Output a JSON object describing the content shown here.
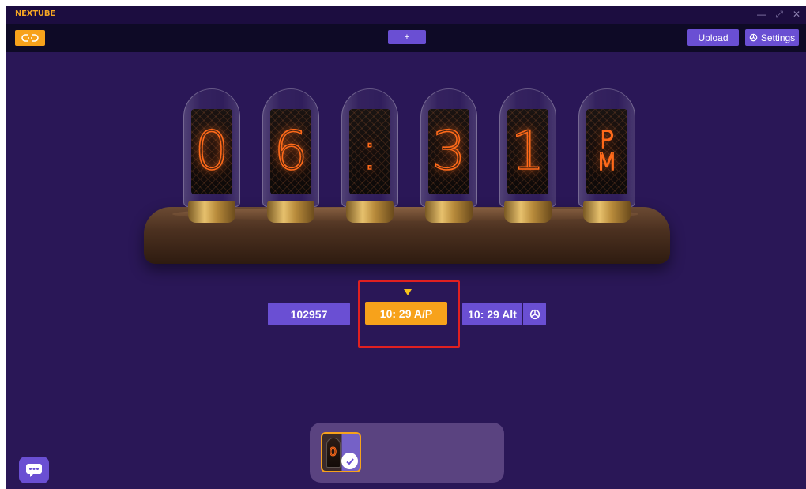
{
  "app": {
    "name": "NEXTUBE"
  },
  "window_controls": {
    "minimize": "—",
    "restore": "⤢",
    "close": "✕"
  },
  "toolbar": {
    "add_label": "+",
    "upload_label": "Upload",
    "settings_label": "Settings"
  },
  "clock": {
    "digits": [
      "0",
      "6",
      ":",
      "3",
      "1"
    ],
    "ampm": [
      "P",
      "M"
    ]
  },
  "modes": {
    "items": [
      {
        "label": "102957",
        "selected": false
      },
      {
        "label": "10: 29 A/P",
        "selected": true
      },
      {
        "label": "10: 29 Alt",
        "selected": false
      }
    ]
  },
  "tray": {
    "thumbnail_digit": "0"
  },
  "colors": {
    "accent": "#f7a21b",
    "primary": "#6a4fd3",
    "background": "#2a1757",
    "highlight": "#e02020"
  },
  "icons": [
    "link-icon",
    "gear-icon",
    "check-icon",
    "chat-icon"
  ]
}
